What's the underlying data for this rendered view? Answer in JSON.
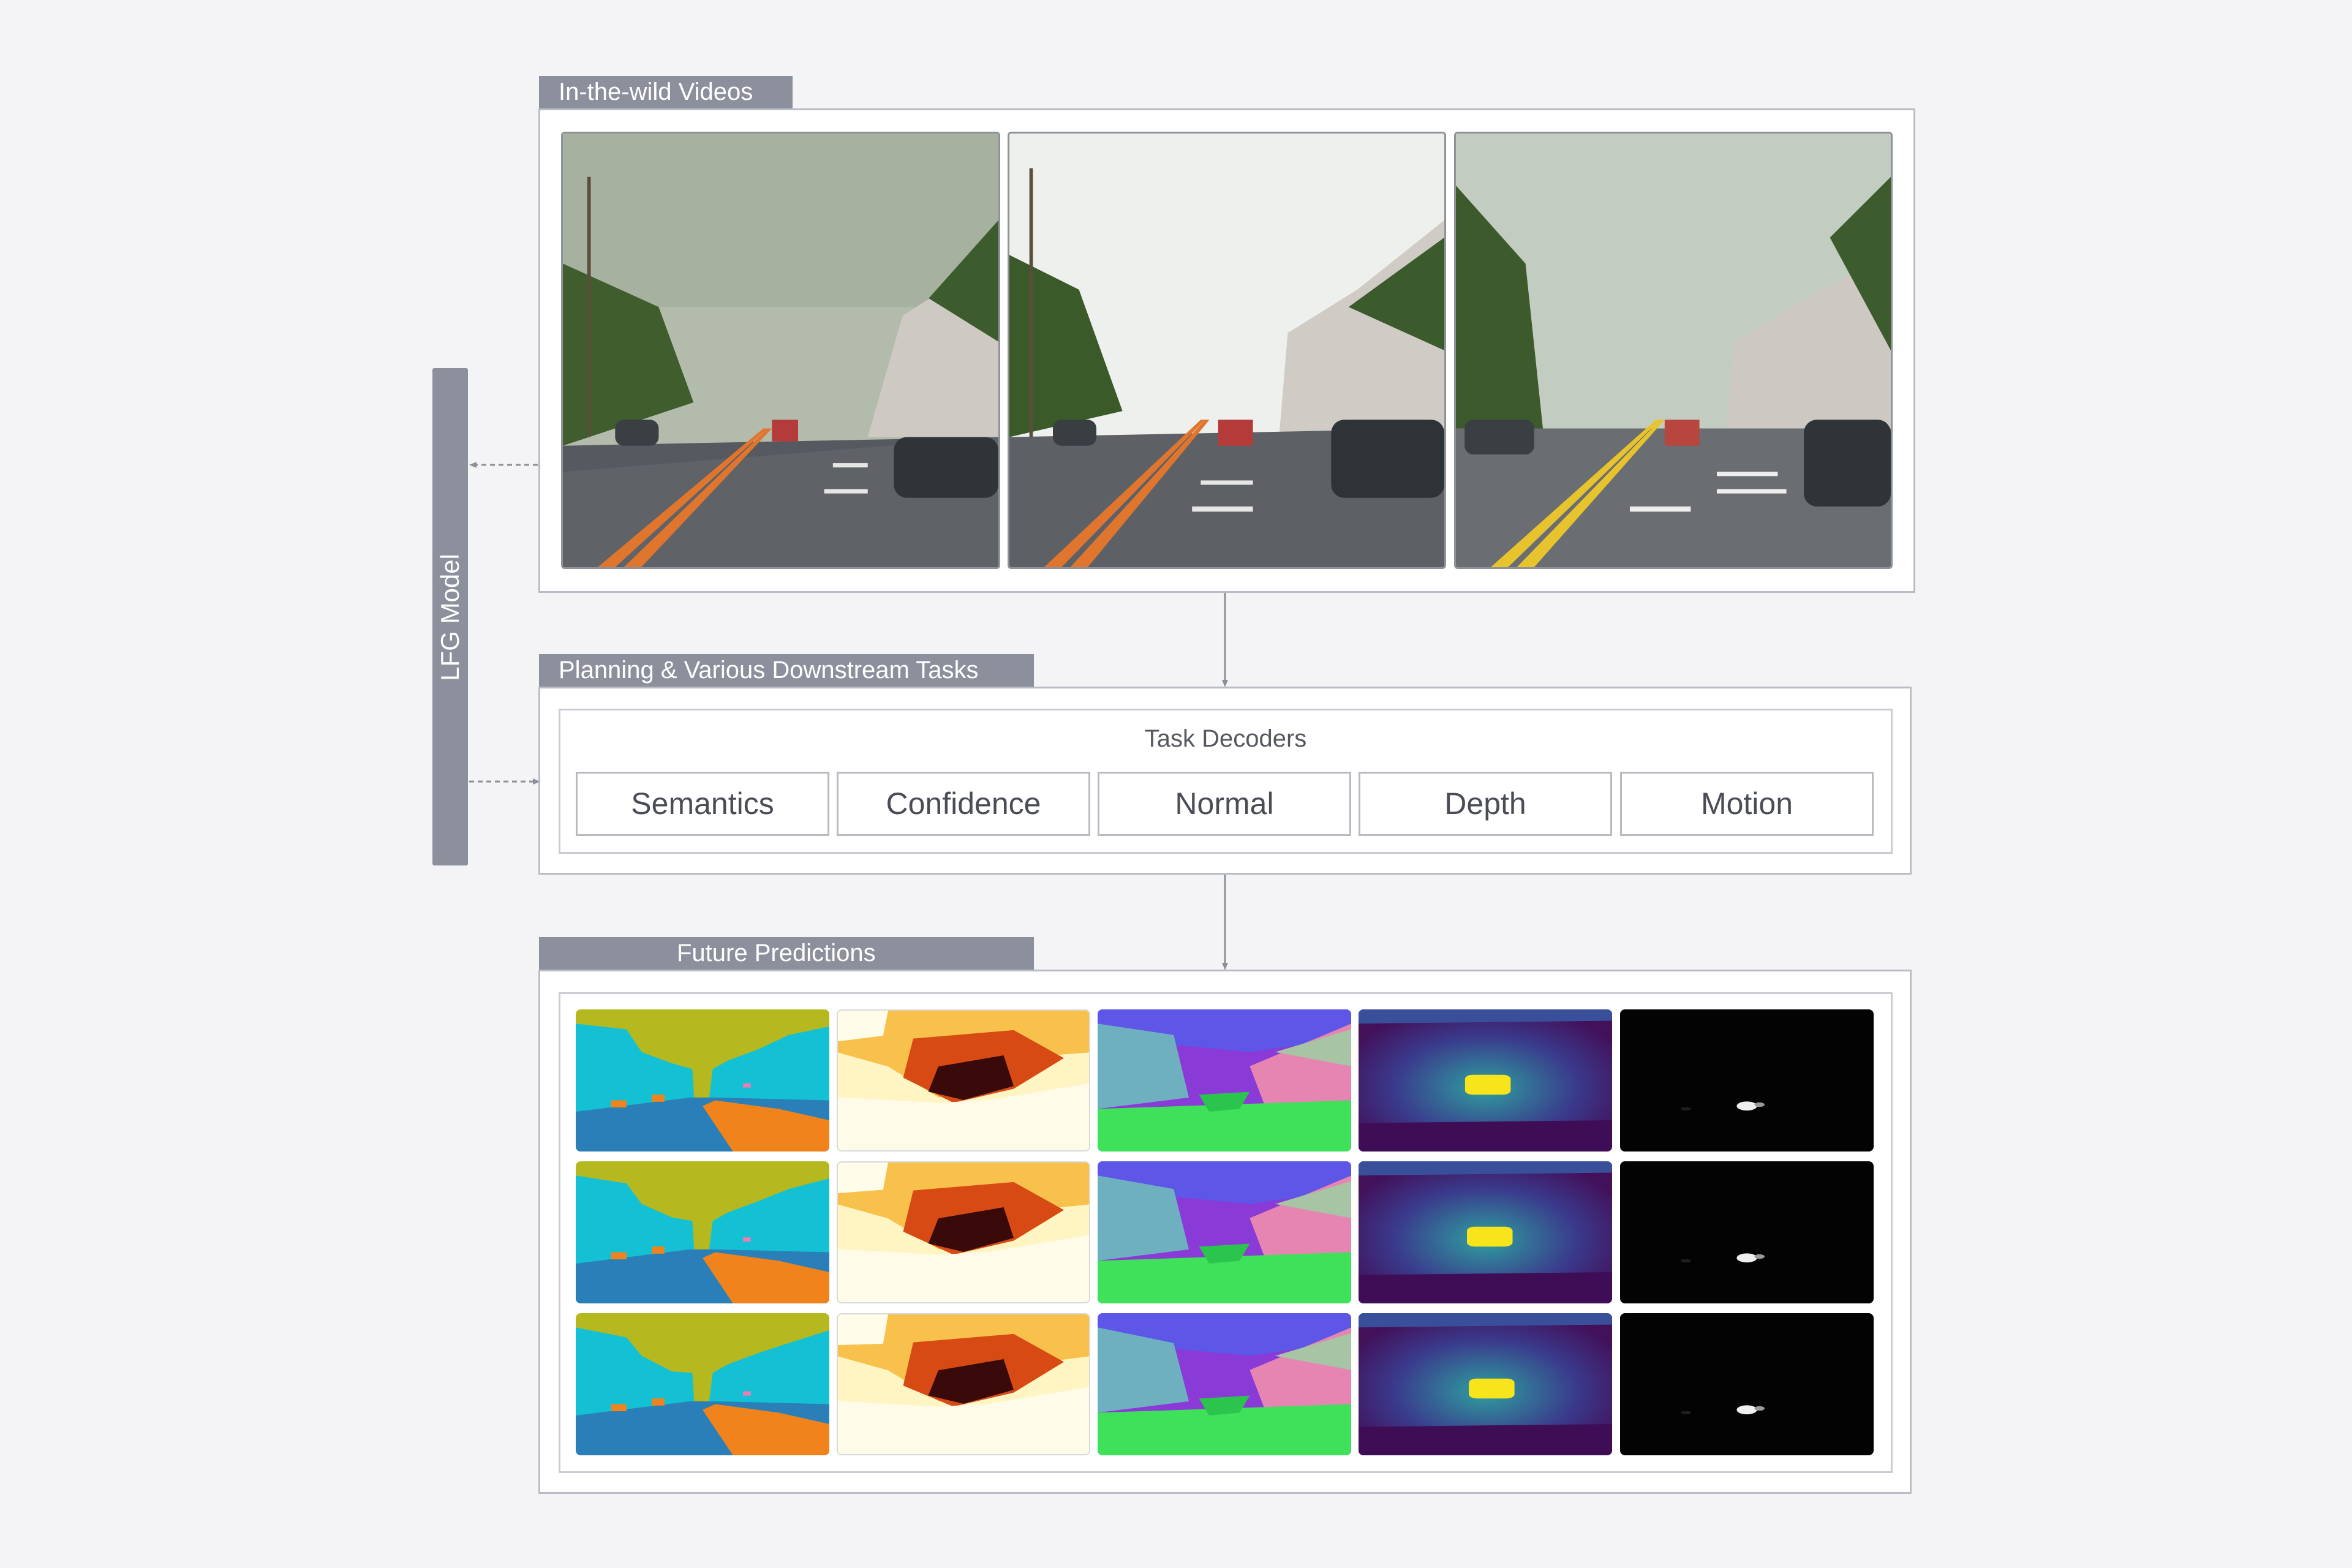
{
  "sections": {
    "videos_title": "In-the-wild Videos",
    "planning_title": "Planning & Various Downstream Tasks",
    "future_title": "Future Predictions"
  },
  "model": {
    "label": "LFG Model"
  },
  "decoders": {
    "title": "Task Decoders",
    "items": [
      "Semantics",
      "Confidence",
      "Normal",
      "Depth",
      "Motion"
    ]
  },
  "prediction_rows": 3
}
